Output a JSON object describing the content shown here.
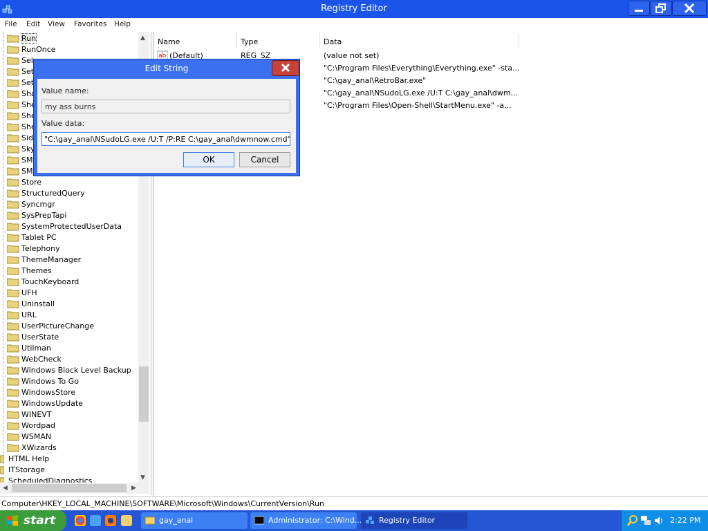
{
  "window": {
    "title": "Registry Editor"
  },
  "menu": [
    "File",
    "Edit",
    "View",
    "Favorites",
    "Help"
  ],
  "tree": {
    "items": [
      "Run",
      "RunOnce",
      "Sel",
      "Set",
      "Set",
      "Sha",
      "She",
      "She",
      "She",
      "Sid",
      "Sky",
      "SM",
      "SM",
      "Store",
      "StructuredQuery",
      "Syncmgr",
      "SysPrepTapi",
      "SystemProtectedUserData",
      "Tablet PC",
      "Telephony",
      "ThemeManager",
      "Themes",
      "TouchKeyboard",
      "UFH",
      "Uninstall",
      "URL",
      "UserPictureChange",
      "UserState",
      "Utilman",
      "WebCheck",
      "Windows Block Level Backup",
      "Windows To Go",
      "WindowsStore",
      "WindowsUpdate",
      "WINEVT",
      "Wordpad",
      "WSMAN",
      "XWizards"
    ],
    "root_items": [
      "HTML Help",
      "ITStorage",
      "ScheduledDiagnostics"
    ]
  },
  "list": {
    "columns": [
      "Name",
      "Type",
      "Data"
    ],
    "rows": [
      {
        "name": "(Default)",
        "type": "REG_SZ",
        "data": "(value not set)"
      },
      {
        "name": "",
        "type": "",
        "data": "\"C:\\Program Files\\Everything\\Everything.exe\" -sta..."
      },
      {
        "name": "",
        "type": "",
        "data": "\"C:\\gay_anal\\RetroBar.exe\""
      },
      {
        "name": "",
        "type": "",
        "data": "\"C:\\gay_anal\\NSudoLG.exe /U:T C:\\gay_anal\\dwm..."
      },
      {
        "name": "",
        "type": "",
        "data": "\"C:\\Program Files\\Open-Shell\\StartMenu.exe\" -a..."
      }
    ]
  },
  "dialog": {
    "title": "Edit String",
    "value_name_label": "Value name:",
    "value_name": "my ass burns",
    "value_data_label": "Value data:",
    "value_data": "\"C:\\gay_anal\\NSudoLG.exe /U:T /P:RE C:\\gay_anal\\dwmnow.cmd\"",
    "ok_label": "OK",
    "cancel_label": "Cancel"
  },
  "status": {
    "path": "Computer\\HKEY_LOCAL_MACHINE\\SOFTWARE\\Microsoft\\Windows\\CurrentVersion\\Run"
  },
  "taskbar": {
    "start_label": "start",
    "buttons": [
      "gay_anal",
      "Administrator: C:\\Wind...",
      "Registry Editor"
    ],
    "clock": "2:22 PM"
  },
  "colors": {
    "titlebar": "#1a54ea",
    "taskbar": "#2456d6",
    "start": "#3a9c3a",
    "tray": "#0f8ee8"
  }
}
